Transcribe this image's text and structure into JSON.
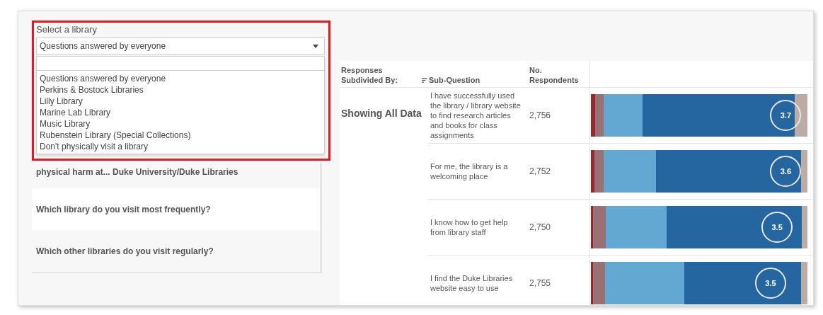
{
  "filter": {
    "label": "Select a library",
    "value": "Questions answered by everyone",
    "options": [
      {
        "label": "Questions answered by everyone"
      },
      {
        "label": "Perkins & Bostock Libraries"
      },
      {
        "label": "Lilly Library"
      },
      {
        "label": "Marine Lab Library"
      },
      {
        "label": "Music Library"
      },
      {
        "label": "Rubenstein Library (Special Collections)"
      },
      {
        "label": "Don't physically visit a library"
      }
    ]
  },
  "questions": [
    {
      "text": "physical harm at... Duke University/Duke Libraries",
      "kind": "partial"
    },
    {
      "text": "Which library do you visit most frequently?",
      "kind": "full"
    },
    {
      "text": "Which other libraries do you visit regularly?",
      "kind": "full"
    }
  ],
  "table": {
    "columns": [
      "Responses Subdivided By:",
      "Sub-Question",
      "No. Respondents"
    ],
    "group": "Showing All Data",
    "rows": [
      {
        "sub_question": "I have successfully used the library / library website to find research articles and books for class assignments",
        "respondents": "2,756",
        "mean": "3.7"
      },
      {
        "sub_question": "For me, the library is a welcoming place",
        "respondents": "2,752",
        "mean": "3.6"
      },
      {
        "sub_question": "I know how to get help from library staff",
        "respondents": "2,750",
        "mean": "3.5"
      },
      {
        "sub_question": "I find the Duke Libraries website easy to use",
        "respondents": "2,755",
        "mean": "3.5"
      }
    ]
  }
}
